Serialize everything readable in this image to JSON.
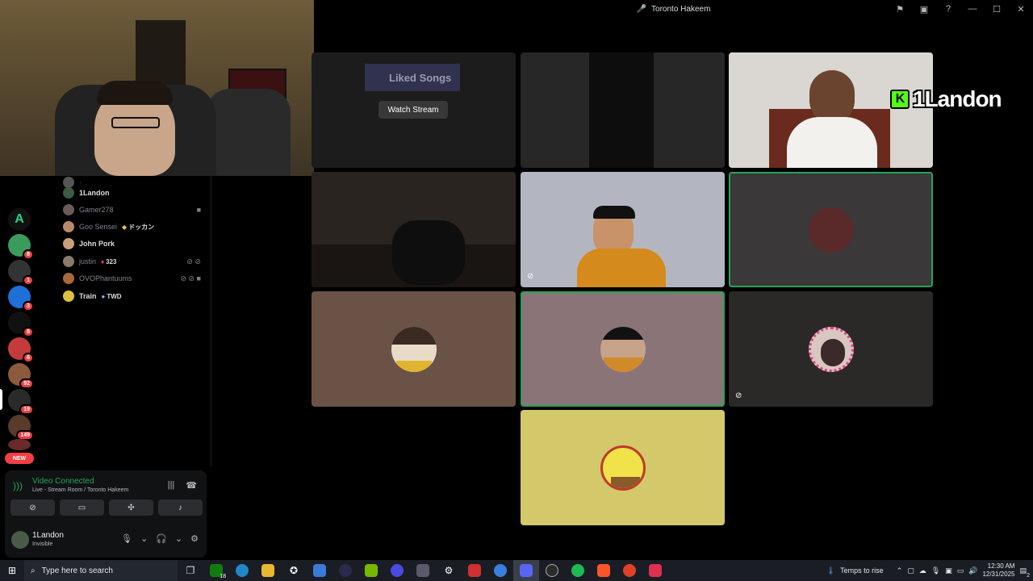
{
  "window": {
    "title": "Toronto Hakeem"
  },
  "members": [
    {
      "name": "1Landon",
      "dim": false
    },
    {
      "name": "Gamer278",
      "dim": true
    },
    {
      "name": "Goo Sensei",
      "dim": true,
      "tag": "ドッカン"
    },
    {
      "name": "John Pork",
      "dim": false
    },
    {
      "name": "justin",
      "dim": true,
      "tag": "323"
    },
    {
      "name": "OVOPhantuums",
      "dim": true
    },
    {
      "name": "Train",
      "dim": false,
      "tag": "TWD"
    }
  ],
  "rail": {
    "badges": [
      "8",
      "1",
      "3",
      "8",
      "6",
      "92",
      "19",
      "149"
    ],
    "new_label": "NEW"
  },
  "voice": {
    "status": "Video Connected",
    "location": "Live - Stream Room / Toronto Hakeem"
  },
  "user": {
    "name": "1Landon",
    "status": "Invisible"
  },
  "stage": {
    "watch_stream": "Watch Stream",
    "liked_songs": "Liked Songs",
    "overlay_name": "1Landon",
    "overlay_logo": "K"
  },
  "taskbar": {
    "search_placeholder": "Type here to search",
    "weather": "Temps to rise",
    "time": "12:30 AM",
    "date": "12/31/2025",
    "xbox_badge": "18",
    "notification_count": "2"
  },
  "colors": {
    "speaking": "#23a55a",
    "danger": "#f23f43",
    "tile_brown": "#6b5246",
    "tile_mauve": "#8a7477",
    "tile_dark": "#2b2828",
    "tile_yellow": "#d3c86a"
  }
}
